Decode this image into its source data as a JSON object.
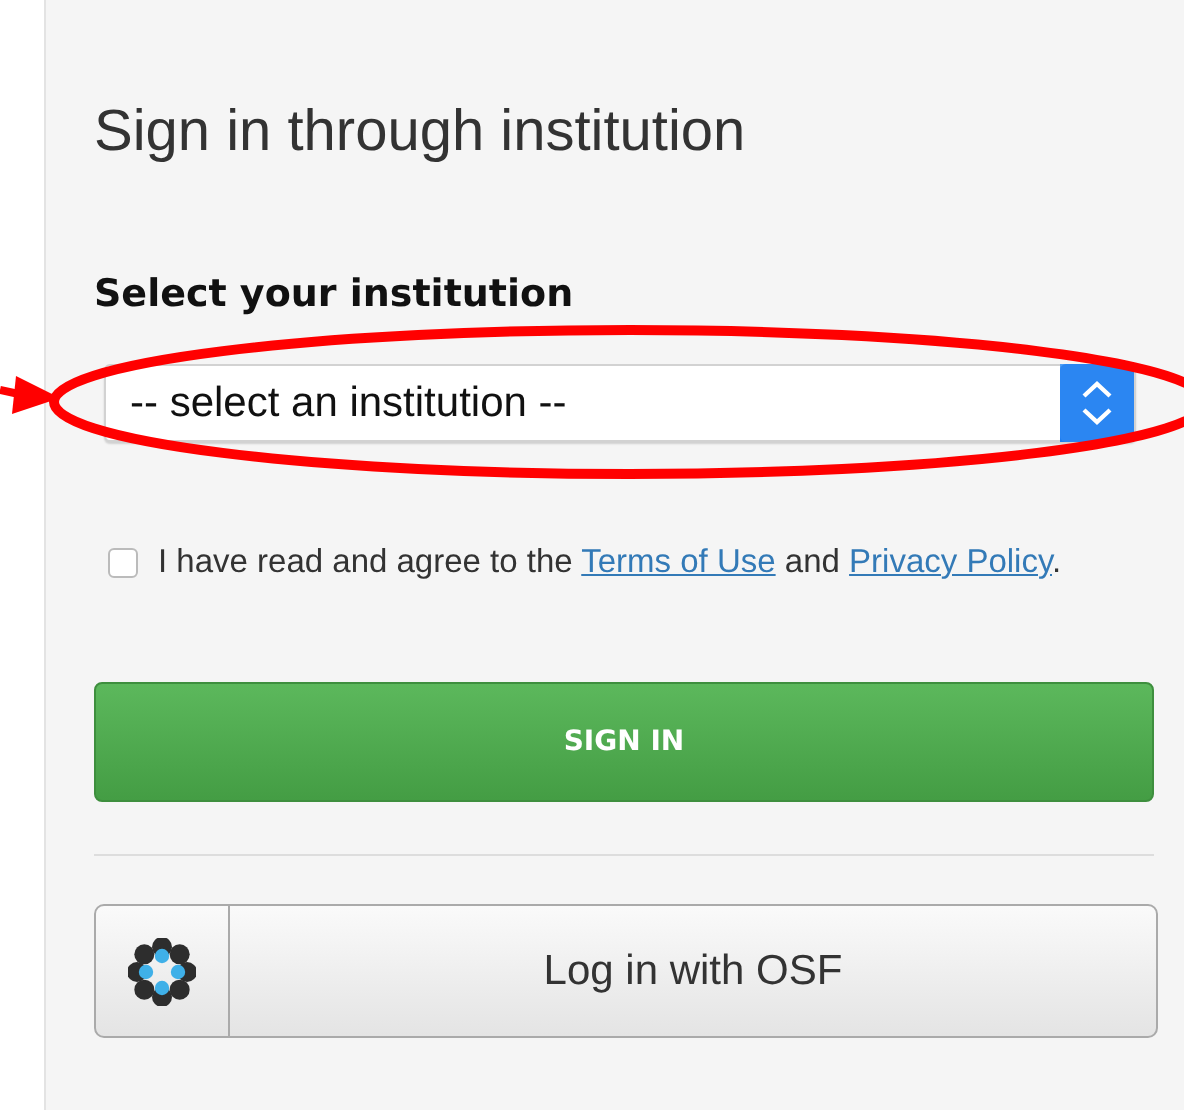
{
  "title": "Sign in through institution",
  "institution_label": "Select your institution",
  "institution_select": {
    "value": "-- select an institution --"
  },
  "agreement": {
    "checked": false,
    "text_before": "I have read and agree to the",
    "terms_link": "Terms of Use",
    "middle": "and",
    "privacy_link": "Privacy Policy",
    "text_after": "."
  },
  "sign_in_button": "SIGN IN",
  "osf_button": "Log in with OSF"
}
